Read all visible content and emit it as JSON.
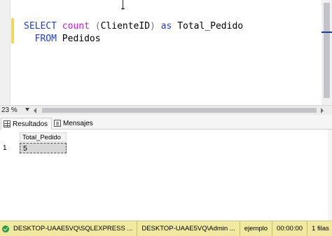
{
  "editor": {
    "line1": {
      "kw_select": "SELECT",
      "fn_count": "count",
      "paren_open": "(",
      "column": "ClienteID",
      "paren_close": ")",
      "kw_as": "as",
      "alias": "Total_Pedido"
    },
    "line2": {
      "kw_from": "FROM",
      "table": "Pedidos"
    }
  },
  "zoom": {
    "value": "23 %"
  },
  "tabs": [
    {
      "label": "Resultados",
      "icon": "grid-icon"
    },
    {
      "label": "Mensajes",
      "icon": "messages-icon"
    }
  ],
  "results": {
    "columns": [
      "Total_Pedido"
    ],
    "rows": [
      {
        "num": "1",
        "cells": [
          "5"
        ]
      }
    ]
  },
  "statusbar": {
    "icon": "ok-icon",
    "server": "DESKTOP-UAAE5VQ\\SQLEXPRESS ...",
    "user": "DESKTOP-UAAE5VQ\\Admin ...",
    "database": "ejemplo",
    "elapsed": "00:00:00",
    "rows": "1 filas"
  },
  "colors": {
    "keyword": "#1f3ed8",
    "function": "#c01fd0",
    "statusbar_bg": "#f1e9a1",
    "change_bar": "#f3d55b"
  }
}
